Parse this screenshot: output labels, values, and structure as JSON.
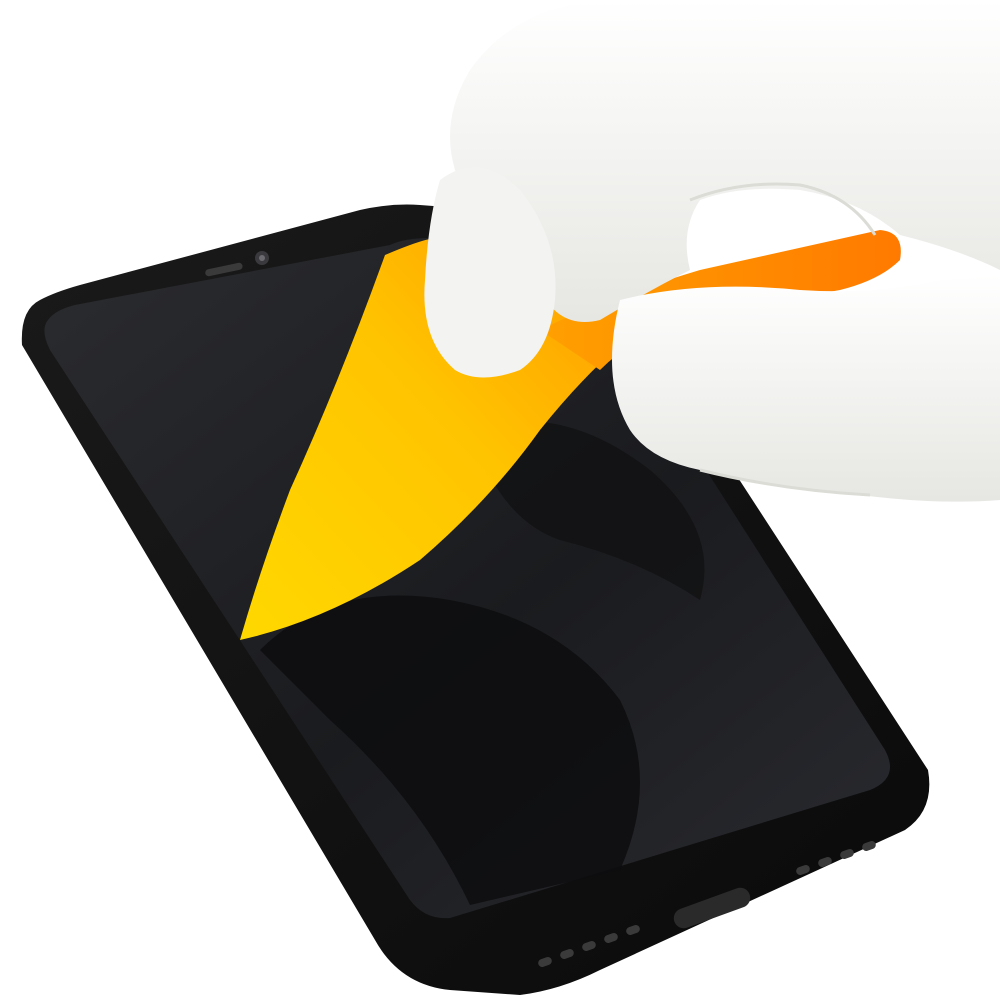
{
  "scene": {
    "background": "#ffffff",
    "objects": [
      {
        "name": "smartphone",
        "color": "#111111"
      },
      {
        "name": "screen",
        "color": "#1c1d20"
      },
      {
        "name": "squeegee-card",
        "color": "#ffd400",
        "handle_color": "#ff7f00"
      },
      {
        "name": "gloved-hand",
        "color": "#f2f2f0"
      }
    ]
  }
}
